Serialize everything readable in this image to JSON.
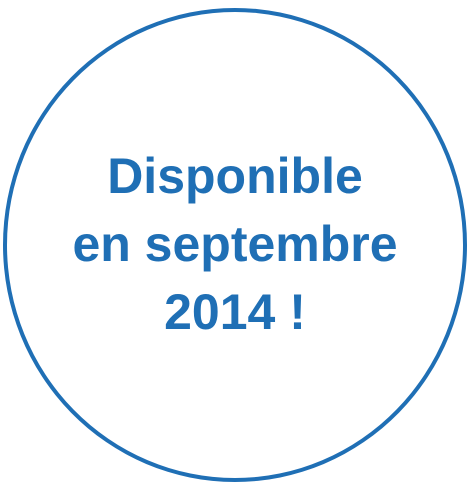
{
  "colors": {
    "accent": "#1f6fb5",
    "background": "#ffffff"
  },
  "badge": {
    "lines": [
      "Disponible",
      "en septembre",
      "2014 !"
    ]
  }
}
